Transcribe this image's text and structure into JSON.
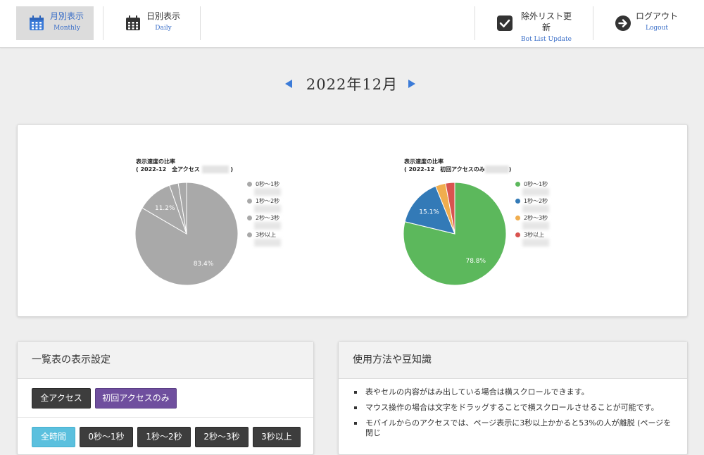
{
  "header": {
    "monthly": {
      "label": "月別表示",
      "sub": "Monthly"
    },
    "daily": {
      "label": "日別表示",
      "sub": "Daily"
    },
    "botlist": {
      "label": "除外リスト更新",
      "sub": "Bot List Update"
    },
    "logout": {
      "label": "ログアウト",
      "sub": "Logout"
    }
  },
  "month": {
    "title": "2022年12月"
  },
  "charts": [
    {
      "title_line1": "表示速度の比率",
      "title_line2": "( 2022-12　全アクセス",
      "title_close": ")",
      "legend": [
        "0秒～1秒",
        "1秒～2秒",
        "2秒～3秒",
        "3秒以上"
      ],
      "slice_labels": [
        "83.4%",
        "11.2%"
      ]
    },
    {
      "title_line1": "表示速度の比率",
      "title_line2": "( 2022-12　初回アクセスのみ",
      "title_close": ")",
      "legend": [
        "0秒～1秒",
        "1秒～2秒",
        "2秒～3秒",
        "3秒以上"
      ],
      "slice_labels": [
        "78.8%",
        "15.1%"
      ]
    }
  ],
  "chart_data": [
    {
      "type": "pie",
      "title": "表示速度の比率 ( 2022-12　全アクセス )",
      "categories": [
        "0秒～1秒",
        "1秒～2秒",
        "2秒～3秒",
        "3秒以上"
      ],
      "values": [
        83.4,
        11.2,
        2.8,
        2.6
      ],
      "colors": [
        "#a9a9a9",
        "#a9a9a9",
        "#a9a9a9",
        "#a9a9a9"
      ],
      "legend_position": "right"
    },
    {
      "type": "pie",
      "title": "表示速度の比率 ( 2022-12　初回アクセスのみ )",
      "categories": [
        "0秒～1秒",
        "1秒～2秒",
        "2秒～3秒",
        "3秒以上"
      ],
      "values": [
        78.8,
        15.1,
        3.2,
        2.9
      ],
      "colors": [
        "#5cb85c",
        "#337ab7",
        "#f0ad4e",
        "#d9534f"
      ],
      "legend_position": "right"
    }
  ],
  "settings": {
    "title": "一覧表の表示設定",
    "buttons_access": [
      "全アクセス",
      "初回アクセスのみ"
    ],
    "buttons_time": [
      "全時間",
      "0秒～1秒",
      "1秒～2秒",
      "2秒～3秒",
      "3秒以上"
    ]
  },
  "tips": {
    "title": "使用方法や豆知識",
    "items": [
      "表やセルの内容がはみ出している場合は横スクロールできます。",
      "マウス操作の場合は文字をドラッグすることで横スクロールさせることが可能です。",
      "モバイルからのアクセスでは、ページ表示に3秒以上かかると53%の人が離脱 (ページを閉じ"
    ]
  }
}
